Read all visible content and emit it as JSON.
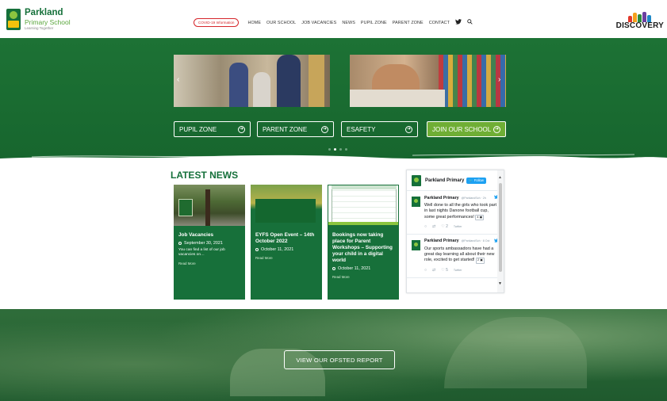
{
  "brand": {
    "name": "Parkland",
    "subname": "Primary School",
    "tagline": "Learning Together",
    "partner": "DISCOVERY"
  },
  "nav": {
    "covid": "COVID-19 Information",
    "items": [
      "HOME",
      "OUR SCHOOL",
      "JOB VACANCIES",
      "NEWS",
      "PUPIL ZONE",
      "PARENT ZONE",
      "CONTACT"
    ],
    "icons": [
      "twitter-icon",
      "search-icon"
    ]
  },
  "hero": {
    "quick_links": [
      "PUPIL ZONE",
      "PARENT ZONE",
      "ESAFETY",
      "JOIN OUR SCHOOL"
    ],
    "slide_count": 4,
    "active_slide": 1
  },
  "news": {
    "heading": "LATEST NEWS",
    "cards": [
      {
        "title": "Job Vacancies",
        "date": "September 30, 2021",
        "excerpt": "You can find a list of our job vacancies on…",
        "more": "Read More"
      },
      {
        "title": "EYFS Open Event – 14th October 2022",
        "date": "October 11, 2021",
        "excerpt": "",
        "more": "Read More"
      },
      {
        "title": "Bookings now taking place for Parent Workshops – Supporting your child in a digital world",
        "date": "October 11, 2021",
        "excerpt": "",
        "more": "Read More"
      }
    ]
  },
  "twitter": {
    "account": "Parkland Primary",
    "follow": "Follow",
    "tweets": [
      {
        "user": "Parkland Primary",
        "handle": "@ParklandSch · 2h",
        "text": "Well done to all the girls who took part in last nights Danone football cup, some great performances!",
        "media": "4",
        "source": "Twitter",
        "likes": "2"
      },
      {
        "user": "Parkland Primary",
        "handle": "@ParklandSch · 8 Oct",
        "text": "Our sports ambassadors have had a great day learning all about their new role, excited to get started!",
        "media": "2",
        "source": "Twitter",
        "likes": "5"
      }
    ]
  },
  "ofsted": {
    "button": "VIEW OUR OFSTED REPORT"
  },
  "colors": {
    "brand_green": "#17703a",
    "accent_lime": "#6fae35",
    "covid_red": "#d6262b",
    "twitter_blue": "#1da1f2"
  }
}
